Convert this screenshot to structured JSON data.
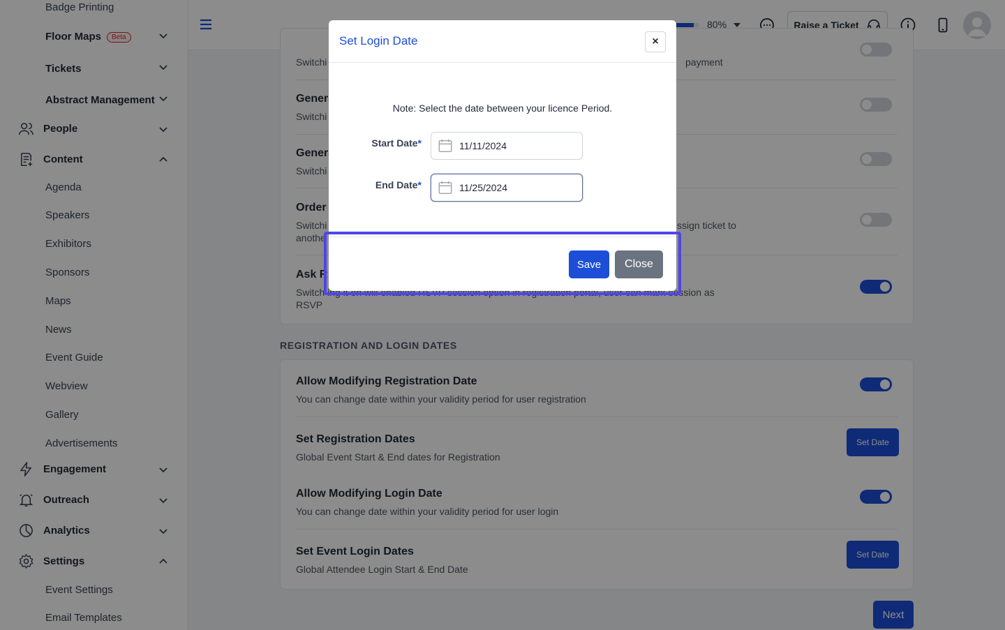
{
  "sidebar": {
    "sub_top": [
      {
        "label": "Badge Printing"
      },
      {
        "label": "Floor Maps",
        "badge": "Beta"
      },
      {
        "label": "Tickets"
      },
      {
        "label": "Abstract Management"
      }
    ],
    "people": "People",
    "content": "Content",
    "content_items": [
      "Agenda",
      "Speakers",
      "Exhibitors",
      "Sponsors",
      "Maps",
      "News",
      "Event Guide",
      "Webview",
      "Gallery",
      "Advertisements"
    ],
    "engagement": "Engagement",
    "outreach": "Outreach",
    "analytics": "Analytics",
    "settings": "Settings",
    "settings_items": [
      "Event Settings",
      "Email Templates"
    ]
  },
  "topbar": {
    "progress_value": 0.8,
    "progress_label": "80%",
    "ticket_label": "Raise a Ticket"
  },
  "settings_top": [
    {
      "title": "",
      "desc_left": "Switchi",
      "desc_right": "payment"
    },
    {
      "title_left": "Genera",
      "desc_left": "Switchi",
      "toggle": "off"
    },
    {
      "title_left": "Genera",
      "desc_left": "Switchi",
      "toggle": "off"
    },
    {
      "title_left": "Order",
      "desc_left": "Switchi",
      "desc_left2": "anothe",
      "desc_right": "ssign ticket to",
      "toggle": "off"
    },
    {
      "title_left": "Ask R",
      "desc_line1": "Switch ing it on will enabled RSVP session option in registration portal, user can mark session as",
      "desc_line2": "RSVP",
      "toggle": "on"
    }
  ],
  "registration_section": {
    "heading": "REGISTRATION AND LOGIN DATES",
    "rows": [
      {
        "title": "Allow Modifying Registration Date",
        "desc": "You can change date within your validity period for user registration",
        "control": "toggle-on"
      },
      {
        "title": "Set Registration Dates",
        "desc": "Global Event Start & End dates for Registration",
        "control": "Set Date"
      },
      {
        "title": "Allow Modifying Login Date",
        "desc": "You can change date within your validity period for user login",
        "control": "toggle-on"
      },
      {
        "title": "Set Event Login Dates",
        "desc": "Global Attendee Login Start & End Date",
        "control": "Set Date"
      }
    ],
    "next_label": "Next"
  },
  "modal": {
    "title": "Set Login Date",
    "close_symbol": "×",
    "note": "Note: Select the date between your licence Period.",
    "start_label": "Start Date",
    "end_label": "End Date",
    "required_mark": "*",
    "start_value": "11/11/2024",
    "end_value": "11/25/2024",
    "save_label": "Save",
    "close_label": "Close"
  },
  "colors": {
    "primary": "#1d4ed8",
    "highlight": "#4f46e5",
    "secondary_button": "#6b7280"
  }
}
